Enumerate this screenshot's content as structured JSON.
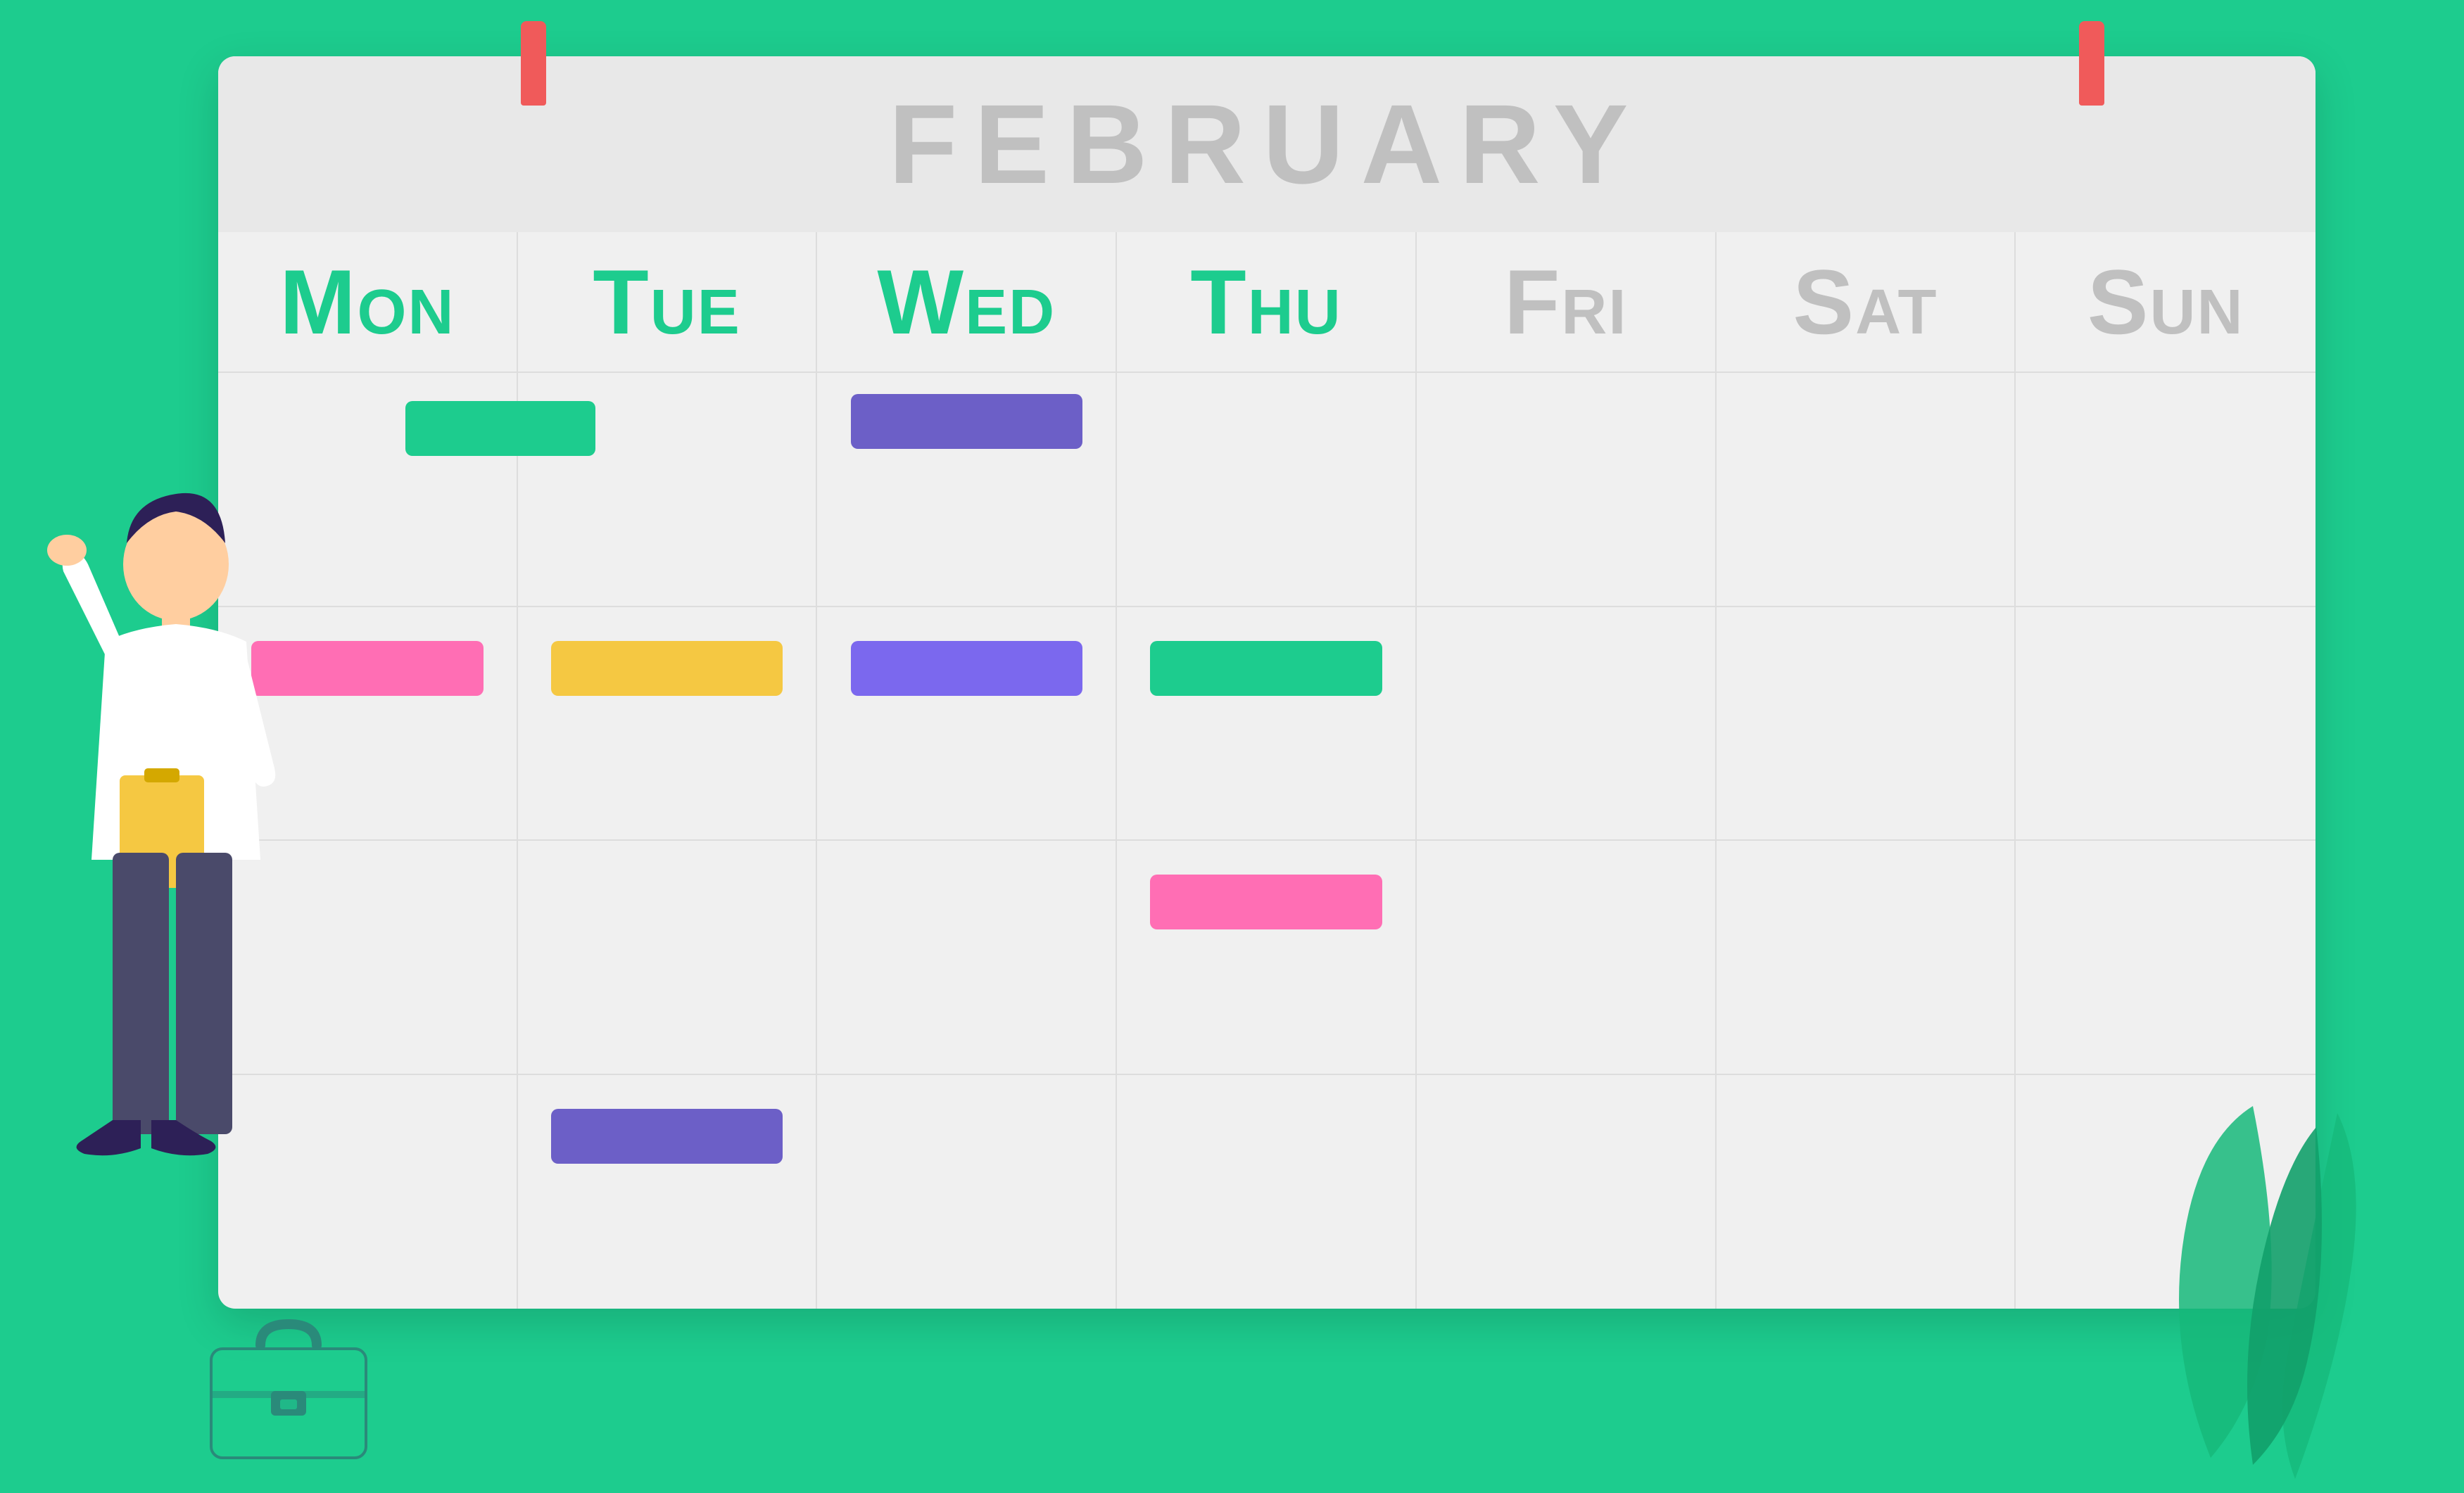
{
  "calendar": {
    "month": "FEBRUARY",
    "days": [
      {
        "label": "Mon",
        "active": true
      },
      {
        "label": "Tue",
        "active": true
      },
      {
        "label": "Wed",
        "active": true
      },
      {
        "label": "Thu",
        "active": true
      },
      {
        "label": "Fri",
        "active": false
      },
      {
        "label": "Sat",
        "active": false
      },
      {
        "label": "Sun",
        "active": false
      }
    ],
    "events": {
      "mon_row1": {
        "color": "teal",
        "visible": true
      },
      "mon_row2": {
        "color": "pink",
        "visible": true
      },
      "tue_row2": {
        "color": "yellow",
        "visible": true
      },
      "tue_row4": {
        "color": "purple-dark",
        "visible": true
      },
      "wed_row1": {
        "color": "purple-dark",
        "visible": true
      },
      "wed_row3": {
        "color": "purple-light",
        "visible": true
      },
      "thu_row2": {
        "color": "teal2",
        "visible": true
      },
      "thu_row3": {
        "color": "pink2",
        "visible": true
      }
    }
  },
  "colors": {
    "background": "#1dcc8e",
    "calendar_bg": "#f0f0f0",
    "calendar_header_bg": "#e8e8e8",
    "text_active": "#1dcc8e",
    "text_inactive": "#c0c0c0",
    "pin": "#f05a5a",
    "bar_teal": "#1dcc8e",
    "bar_pink": "#ff6eb4",
    "bar_yellow": "#f5c842",
    "bar_purple_dark": "#6c5fc7",
    "bar_purple_light": "#7b68ee"
  }
}
